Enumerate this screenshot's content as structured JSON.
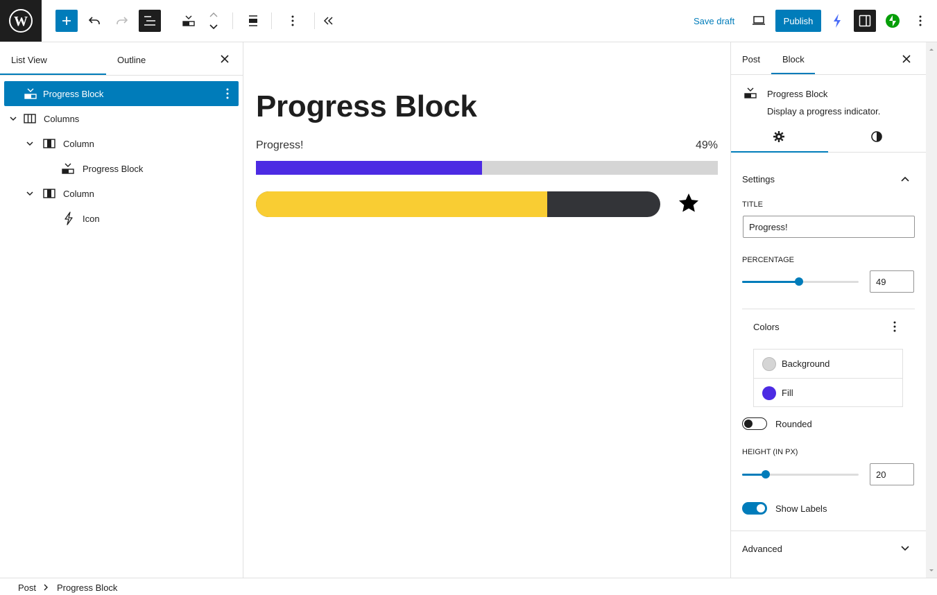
{
  "toolbar": {
    "logo": "wordpress-logo",
    "save_draft": "Save draft",
    "publish": "Publish"
  },
  "list_view": {
    "tab_list": "List View",
    "tab_outline": "Outline",
    "items": [
      {
        "label": "Progress Block",
        "icon": "progress-icon",
        "selected": true
      },
      {
        "label": "Columns",
        "icon": "columns-icon"
      },
      {
        "label": "Column",
        "icon": "column-icon"
      },
      {
        "label": "Progress Block",
        "icon": "progress-icon"
      },
      {
        "label": "Column",
        "icon": "column-icon"
      },
      {
        "label": "Icon",
        "icon": "bolt-icon"
      }
    ]
  },
  "canvas": {
    "title": "Progress Block",
    "progress_label": "Progress!",
    "progress_percent_label": "49%",
    "progress_value": 0.49,
    "bar2_value": 0.72,
    "colors": {
      "track": "#d5d5d5",
      "fill": "#4c2be3",
      "bar2_fill": "#f9cd33",
      "bar2_track": "#333438"
    }
  },
  "inspector": {
    "tab_post": "Post",
    "tab_block": "Block",
    "block_name": "Progress Block",
    "block_desc": "Display a progress indicator.",
    "settings_title": "Settings",
    "title_label": "TITLE",
    "title_value": "Progress!",
    "percentage_label": "PERCENTAGE",
    "percentage_value": "49",
    "percentage_fraction": 0.49,
    "colors_title": "Colors",
    "color_background": "Background",
    "color_fill": "Fill",
    "background_hex": "#d5d5d5",
    "fill_hex": "#4c2be3",
    "rounded_label": "Rounded",
    "rounded_on": false,
    "height_label": "HEIGHT (IN PX)",
    "height_value": "20",
    "height_fraction": 0.2,
    "show_labels_label": "Show Labels",
    "show_labels_on": true,
    "advanced_title": "Advanced"
  },
  "footer": {
    "crumb_root": "Post",
    "crumb_current": "Progress Block"
  }
}
